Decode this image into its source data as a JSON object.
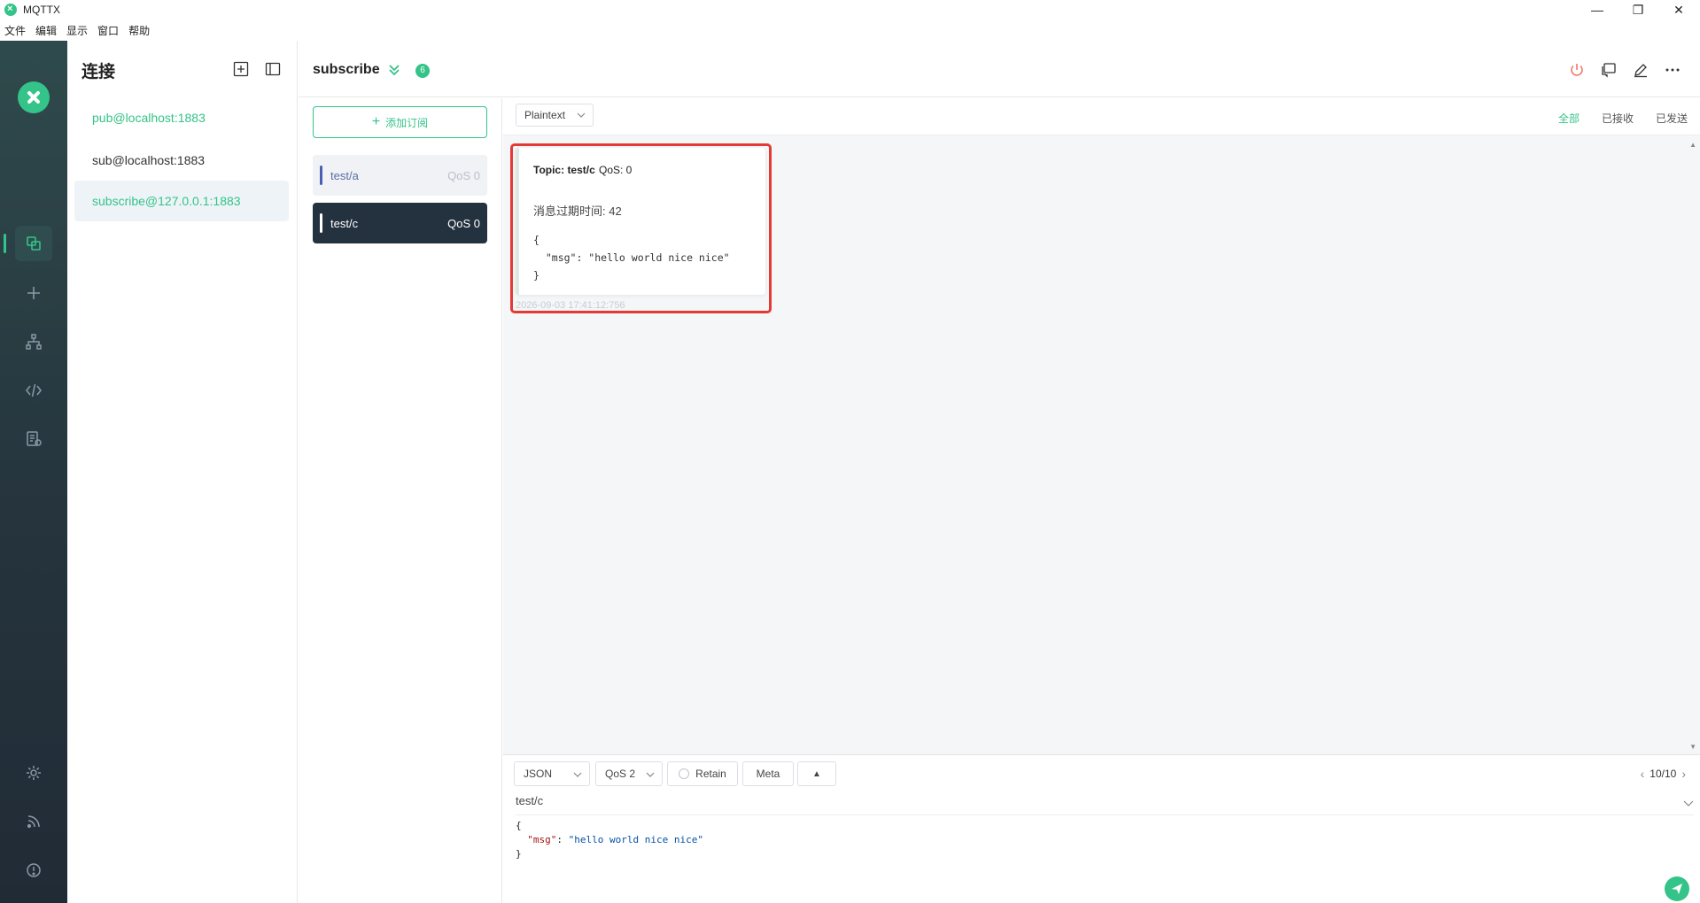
{
  "window": {
    "title": "MQTTX",
    "minimize": "—",
    "restore": "❐",
    "close": "✕"
  },
  "menu": [
    "文件",
    "编辑",
    "显示",
    "窗口",
    "帮助"
  ],
  "connections": {
    "title": "连接",
    "items": [
      {
        "label": "pub@localhost:1883"
      },
      {
        "label": "sub@localhost:1883"
      },
      {
        "label": "subscribe@127.0.0.1:1883"
      }
    ]
  },
  "header": {
    "title": "subscribe",
    "badge": "6"
  },
  "subscriptions": {
    "add_label": "添加订阅",
    "items": [
      {
        "topic": "test/a",
        "qos": "QoS 0",
        "color": "#4a5fb3"
      },
      {
        "topic": "test/c",
        "qos": "QoS 0",
        "color": "#ffffff"
      }
    ]
  },
  "toolbar": {
    "format": "Plaintext",
    "filters": [
      "全部",
      "已接收",
      "已发送"
    ]
  },
  "message": {
    "topic": "Topic: test/c",
    "qos": "QoS: 0",
    "expiry": "消息过期时间: 42",
    "payload": "{\n  \"msg\": \"hello world nice nice\"\n}",
    "time": "2026-09-03 17:41:12:756"
  },
  "composer": {
    "format": "JSON",
    "qos": "QoS 2",
    "retain": "Retain",
    "meta": "Meta",
    "pager": "10/10",
    "topic": "test/c",
    "code_open": "{",
    "code_key": "\"msg\"",
    "code_sep": ": ",
    "code_value": "\"hello world nice nice\"",
    "code_close": "}"
  },
  "colors": {
    "accent": "#34c388",
    "highlight": "#e53935",
    "dark_item": "#24313f"
  }
}
